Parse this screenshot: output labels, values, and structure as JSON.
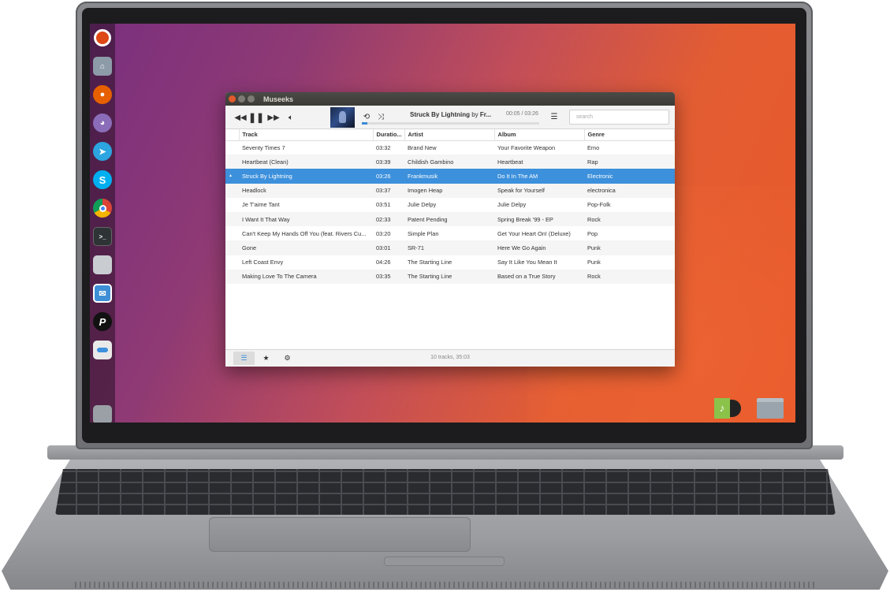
{
  "app": {
    "title": "Museeks",
    "now_playing": {
      "track": "Struck By Lightning",
      "by": "by",
      "artist_truncated": "Fr...",
      "time": "00:05 / 03:26",
      "progress": 0.03
    },
    "search": {
      "placeholder": "search"
    },
    "columns": [
      "Track",
      "Duratio...",
      "Artist",
      "Album",
      "Genre"
    ],
    "tracks": [
      {
        "track": "Seventy Times 7",
        "duration": "03:32",
        "artist": "Brand New",
        "album": "Your Favorite Weapon",
        "genre": "Emo",
        "playing": false
      },
      {
        "track": "Heartbeat (Clean)",
        "duration": "03:39",
        "artist": "Childish Gambino",
        "album": "Heartbeat",
        "genre": "Rap",
        "playing": false
      },
      {
        "track": "Struck By Lightning",
        "duration": "03:26",
        "artist": "Frankmusik",
        "album": "Do It In The AM",
        "genre": "Electronic",
        "playing": true
      },
      {
        "track": "Headlock",
        "duration": "03:37",
        "artist": "Imogen Heap",
        "album": "Speak for Yourself",
        "genre": "electronica",
        "playing": false
      },
      {
        "track": "Je T'aime Tant",
        "duration": "03:51",
        "artist": "Julie Delpy",
        "album": "Julie Delpy",
        "genre": "Pop-Folk",
        "playing": false
      },
      {
        "track": "I Want It That Way",
        "duration": "02:33",
        "artist": "Patent Pending",
        "album": "Spring Break '99 - EP",
        "genre": "Rock",
        "playing": false
      },
      {
        "track": "Can't Keep My Hands Off You (feat. Rivers Cu...",
        "duration": "03:20",
        "artist": "Simple Plan",
        "album": "Get Your Heart On! (Deluxe)",
        "genre": "Pop",
        "playing": false
      },
      {
        "track": "Gone",
        "duration": "03:01",
        "artist": "SR-71",
        "album": "Here We Go Again",
        "genre": "Punk",
        "playing": false
      },
      {
        "track": "Left Coast Envy",
        "duration": "04:26",
        "artist": "The Starting Line",
        "album": "Say It Like You Mean It",
        "genre": "Punk",
        "playing": false
      },
      {
        "track": "Making Love To The Camera",
        "duration": "03:35",
        "artist": "The Starting Line",
        "album": "Based on a True Story",
        "genre": "Rock",
        "playing": false
      }
    ],
    "footer_status": "10 tracks, 35:03"
  },
  "launcher_icons": [
    "ubuntu-icon",
    "home-folder-icon",
    "firefox-icon",
    "pidgin-icon",
    "telegram-icon",
    "skype-icon",
    "chrome-icon",
    "terminal-icon",
    "files-icon",
    "mailspring-icon",
    "pinterest-icon",
    "settings-toggle-icon",
    "trash-icon"
  ],
  "colors": {
    "accent": "#3c90dc",
    "titlebar": "#3c3b37",
    "close": "#e05a2b"
  }
}
